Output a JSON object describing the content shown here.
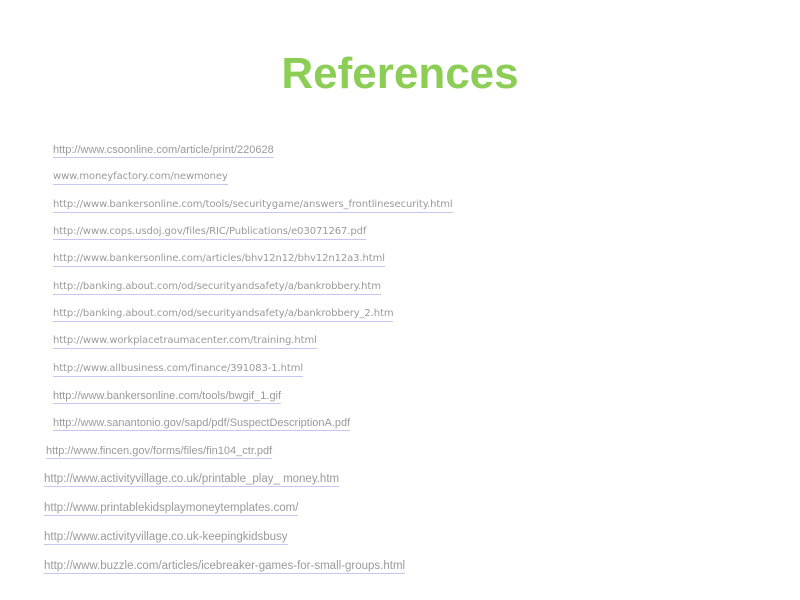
{
  "slide": {
    "title": "References",
    "title_color": "#8cce55",
    "link_color": "#9a9a9a",
    "underline_color": "#c6c6ee"
  },
  "references": [
    "http://www.csoonline.com/article/print/220628",
    "www.moneyfactory.com/newmoney",
    "http://www.bankersonline.com/tools/securitygame/answers_frontlinesecurity.html",
    "http://www.cops.usdoj.gov/files/RIC/Publications/e03071267.pdf",
    "http://www.bankersonline.com/articles/bhv12n12/bhv12n12a3.html",
    "http://banking.about.com/od/securityandsafety/a/bankrobbery.htm",
    "http://banking.about.com/od/securityandsafety/a/bankrobbery_2.htm",
    "http://www.workplacetraumacenter.com/training.html",
    "http://www.allbusiness.com/finance/391083-1.html",
    "http://www.bankersonline.com/tools/bwgif_1.gif",
    "http://www.sanantonio.gov/sapd/pdf/SuspectDescriptionA.pdf",
    "http://www.fincen.gov/forms/files/fin104_ctr.pdf",
    "http://www.activityvillage.co.uk/printable_play_ money.htm",
    "http://www.printablekidsplaymoneytemplates.com/",
    "http://www.activityvillage.co.uk-keepingkidsbusy",
    "http://www.buzzle.com/articles/icebreaker-games-for-small-groups.html"
  ]
}
